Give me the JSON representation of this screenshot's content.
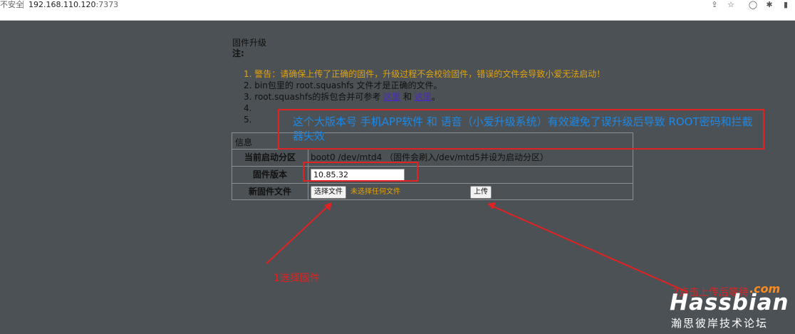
{
  "browser": {
    "security": "不安全",
    "url_host": "192.168.110.120",
    "url_port": ":7373",
    "icons": [
      "share-icon",
      "star-icon",
      "circle-icon",
      "extension-icon",
      "sidebar-icon"
    ]
  },
  "page": {
    "title": "固件升级",
    "note_label": "注:",
    "items": [
      {
        "n": "1.",
        "text": "警告：请确保上传了正确的固件，升级过程不会校验固件，错误的文件会导致小爱无法启动！"
      },
      {
        "n": "2.",
        "text": "bin包里的 root.squashfs 文件才是正确的文件。"
      },
      {
        "n": "3.",
        "pre": "root.squashfs的拆包合并可参考",
        "link1": "这里",
        "mid": "和",
        "link2": "这里",
        "post": "。"
      },
      {
        "n": "4.",
        "text": ""
      },
      {
        "n": "5.",
        "text": ""
      }
    ]
  },
  "info": {
    "header": "信息",
    "rows": [
      {
        "label": "当前启动分区",
        "value": "boot0 /dev/mtd4 （固件会刷入/dev/mtd5并设为启动分区）"
      },
      {
        "label": "固件版本",
        "value": "10.85.32"
      },
      {
        "label": "新固件文件",
        "choose_btn": "选择文件",
        "no_file": "未选择任何文件",
        "upload_btn": "上传"
      }
    ]
  },
  "annotations": {
    "blue_text": "这个大版本号 手机APP软件 和 语音（小爱升级系统）有效避免了误升级后导致 ROOT密码和拦截器失效",
    "step1": "1选择固件",
    "step2": "2点击上传后等待"
  },
  "watermark": {
    "com": ".com",
    "main": "Hassbian",
    "sub": "瀚思彼岸技术论坛"
  },
  "colors": {
    "background": "#4b5155",
    "annotation_red": "#e02222",
    "annotation_blue": "#1e88e5",
    "warning": "#e0a30f"
  }
}
